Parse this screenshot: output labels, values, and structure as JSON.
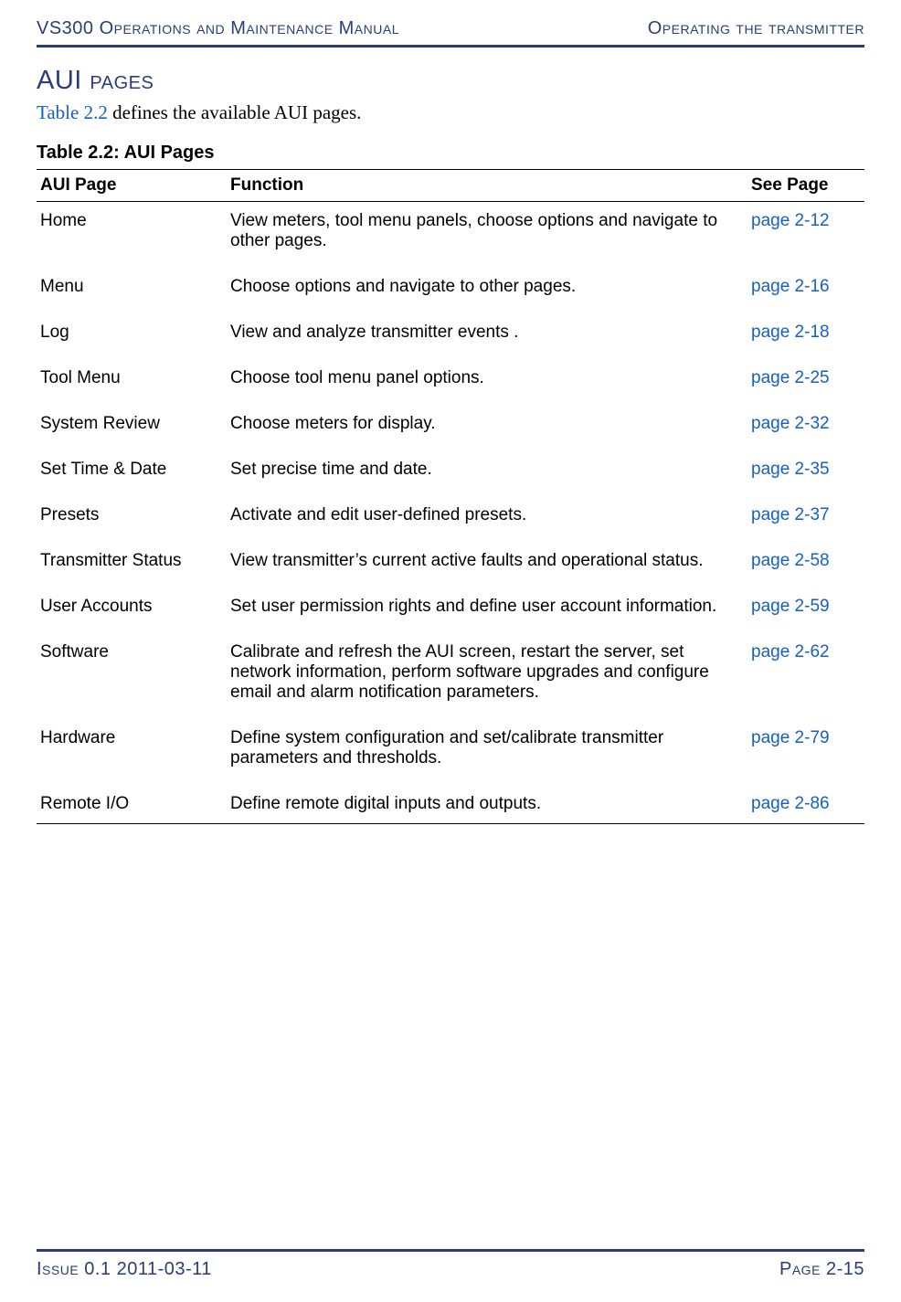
{
  "header": {
    "left": "VS300 Operations and Maintenance Manual",
    "right": "Operating the transmitter"
  },
  "section": {
    "heading": "AUI pages",
    "intro_link": "Table 2.2",
    "intro_rest": " defines the available AUI pages."
  },
  "table": {
    "title": "Table 2.2: AUI Pages",
    "headers": {
      "page": "AUI Page",
      "function": "Function",
      "see": "See Page"
    },
    "rows": [
      {
        "page": "Home",
        "function": "View meters, tool menu panels, choose options and navigate to other pages.",
        "see": "page 2-12"
      },
      {
        "page": "Menu",
        "function": "Choose options and navigate to other pages.",
        "see": "page 2-16"
      },
      {
        "page": "Log",
        "function": "View and analyze transmitter events .",
        "see": "page 2-18"
      },
      {
        "page": "Tool Menu",
        "function": "Choose tool menu panel options.",
        "see": "page 2-25"
      },
      {
        "page": "System Review",
        "function": "Choose meters for display.",
        "see": "page 2-32"
      },
      {
        "page": "Set Time & Date",
        "function": "Set precise time and date.",
        "see": "page 2-35"
      },
      {
        "page": "Presets",
        "function": "Activate and edit user-defined presets.",
        "see": "page 2-37"
      },
      {
        "page": "Transmitter Status",
        "function": "View transmitter’s current active faults and operational status.",
        "see": "page 2-58"
      },
      {
        "page": "User Accounts",
        "function": "Set user permission rights and define user account information.",
        "see": "page 2-59"
      },
      {
        "page": "Software",
        "function": "Calibrate and refresh the AUI screen, restart the server, set network information, perform software upgrades and configure email and alarm notification parameters.",
        "see": "page 2-62"
      },
      {
        "page": "Hardware",
        "function": "Define system configuration and set/calibrate transmitter parameters and thresholds.",
        "see": "page 2-79"
      },
      {
        "page": "Remote I/O",
        "function": "Define remote digital inputs and outputs.",
        "see": "page 2-86"
      }
    ]
  },
  "footer": {
    "left": "Issue 0.1  2011-03-11",
    "right": "Page 2-15"
  }
}
